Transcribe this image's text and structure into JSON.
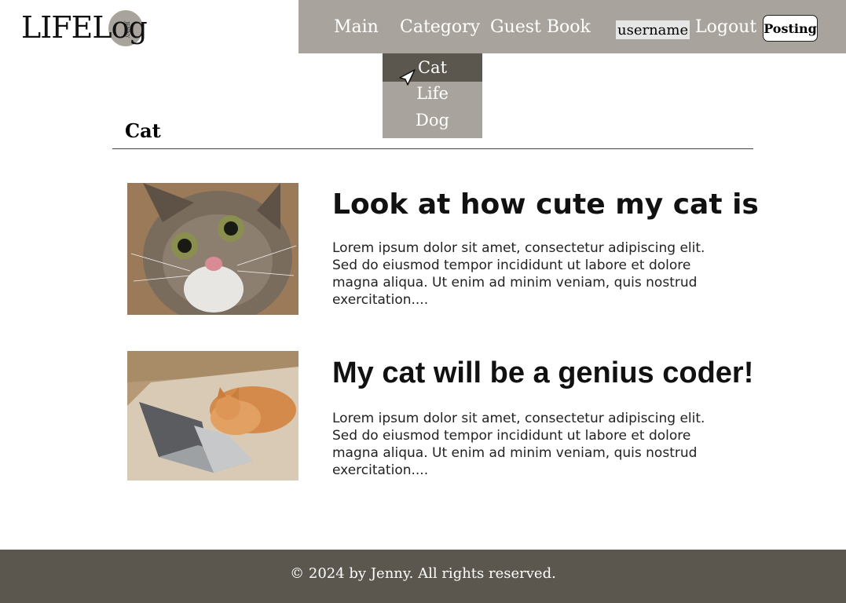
{
  "brand": {
    "logo_text": "LIFELog",
    "logo_tag": "JENNY"
  },
  "nav": {
    "main": "Main",
    "category": "Category",
    "guest_book": "Guest Book",
    "username": "username",
    "logout": "Logout",
    "posting": "Posting"
  },
  "dropdown": {
    "items": [
      "Cat",
      "Life",
      "Dog"
    ],
    "selected": "Cat"
  },
  "page": {
    "title": "Cat"
  },
  "posts": [
    {
      "title": "Look at how cute my cat is",
      "excerpt": "Lorem ipsum dolor sit amet, consectetur adipiscing elit. Sed do eiusmod tempor incididunt ut labore et dolore magna aliqua. Ut enim ad minim veniam, quis nostrud exercitation...."
    },
    {
      "title": "My cat will be a genius coder!",
      "excerpt": "Lorem ipsum dolor sit amet, consectetur adipiscing elit. Sed do eiusmod tempor incididunt ut labore et dolore magna aliqua. Ut enim ad minim veniam, quis nostrud exercitation...."
    }
  ],
  "footer": {
    "text": "© 2024 by Jenny. All rights reserved."
  },
  "colors": {
    "nav_bg": "#a8a49d",
    "dropdown_active": "#5b574f",
    "footer_bg": "#5b574f"
  }
}
